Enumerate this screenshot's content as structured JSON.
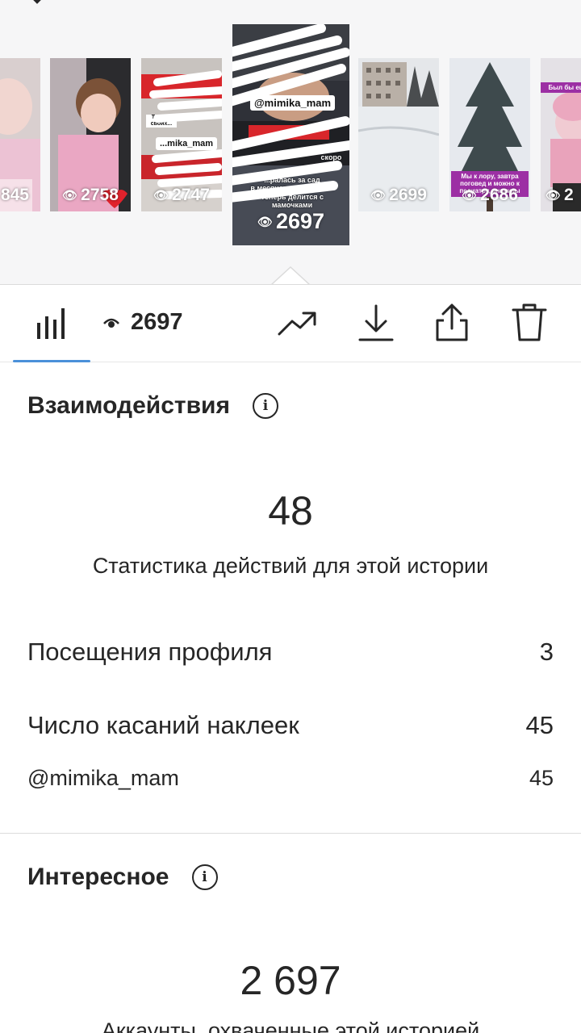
{
  "strip": {
    "thumbnails": [
      {
        "views": "845"
      },
      {
        "views": "2758"
      },
      {
        "views": "2747",
        "chip": "...mika_mam",
        "top_text": "Тот кто своих..."
      },
      {
        "views": "2697",
        "chip": "@mimika_mam",
        "overlay": "...ралась за сад\nв месяцев и выиграла!\nТеперь делится с\nмамочками",
        "side_text": "Уже скоро"
      },
      {
        "views": "2699"
      },
      {
        "views": "2686",
        "pink": "Мы к лору, завтра поговед и можно к педиатру, анализы"
      },
      {
        "views": "2",
        "pink": "Был бы ещё не"
      }
    ]
  },
  "toolbar": {
    "views": "2697"
  },
  "interactions": {
    "title": "Взаимодействия",
    "total": "48",
    "subtitle": "Статистика действий для этой истории",
    "rows": [
      {
        "label": "Посещения профиля",
        "value": "3"
      },
      {
        "label": "Число касаний наклеек",
        "value": "45"
      }
    ],
    "sticker": {
      "label": "@mimika_mam",
      "value": "45"
    }
  },
  "discovery": {
    "title": "Интересное",
    "total": "2 697",
    "cut_text": "Аккаунты, охваченные этой историей"
  },
  "colors": {
    "accent": "#4a90d9",
    "text": "#262626",
    "strip_bg": "#f6f6f7",
    "pink_label": "#9c2fa4"
  },
  "icons": [
    "insights-bars-icon",
    "eye-icon",
    "trending-icon",
    "download-icon",
    "share-icon",
    "trash-icon",
    "info-icon"
  ]
}
